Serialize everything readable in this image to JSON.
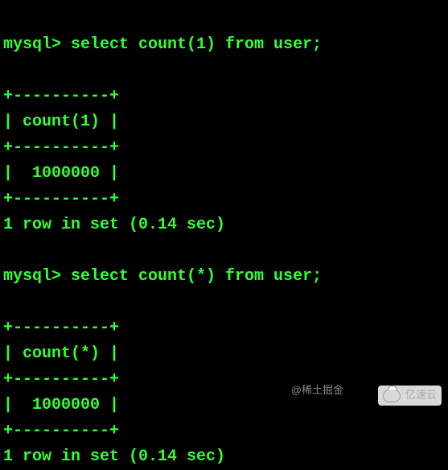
{
  "query1": {
    "prompt": "mysql>",
    "command": " select count(1) from user;",
    "border": "+----------+",
    "header": "| count(1) |",
    "value": "|  1000000 |",
    "status": "1 row in set (0.14 sec)"
  },
  "query2": {
    "prompt": "mysql>",
    "command": " select count(*) from user;",
    "border": "+----------+",
    "header": "| count(*) |",
    "value": "|  1000000 |",
    "status": "1 row in set (0.14 sec)"
  },
  "watermark": {
    "left": "@稀土掘金",
    "right": "亿速云"
  }
}
